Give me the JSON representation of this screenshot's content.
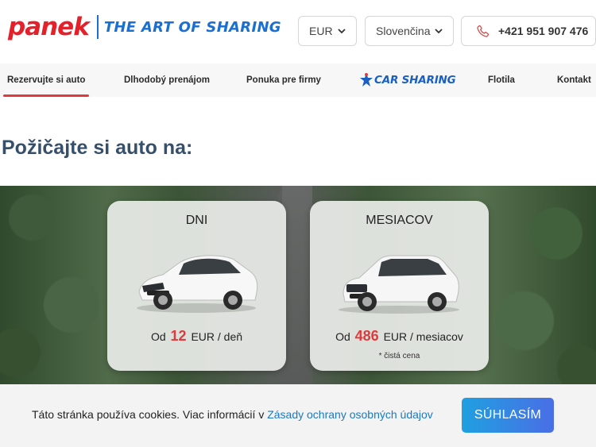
{
  "header": {
    "logo_text": "panek",
    "tagline": "THE ART OF SHARING",
    "currency": "EUR",
    "language": "Slovenčina",
    "phone": "+421 951 907 476",
    "brand_color": "#e4202b",
    "accent_color": "#1a6fd0"
  },
  "nav": {
    "items": [
      {
        "label": "Rezervujte si auto",
        "active": true
      },
      {
        "label": "Dlhodobý prenájom"
      },
      {
        "label": "Ponuka pre firmy"
      },
      {
        "label": "CAR SHARING",
        "icon": "car-sharing-logo"
      },
      {
        "label": "Flotila"
      },
      {
        "label": "Kontakt"
      }
    ]
  },
  "main": {
    "title": "Požičajte si auto na:",
    "cards": [
      {
        "title": "DNI",
        "prefix": "Od",
        "amount": "12",
        "unit": "EUR / deň",
        "note": ""
      },
      {
        "title": "MESIACOV",
        "prefix": "Od",
        "amount": "486",
        "unit": "EUR / mesiacov",
        "note": "* čistá cena"
      }
    ]
  },
  "cookie": {
    "text": "Táto stránka používa cookies. Viac informácií v",
    "link": "Zásady ochrany osobných údajov",
    "button": "SÚHLASÍM"
  }
}
